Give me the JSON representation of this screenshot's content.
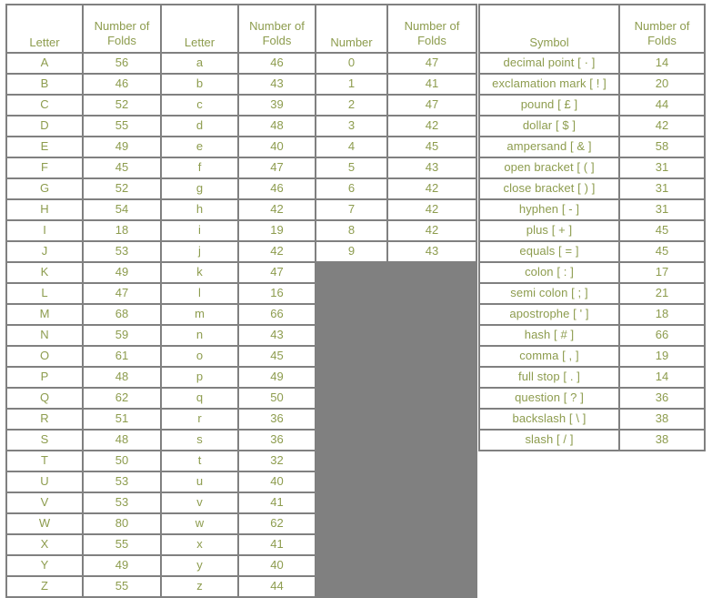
{
  "style": {
    "text_color": "#8d9c4e",
    "grid_color": "#808080",
    "background": "#ffffff"
  },
  "headers": {
    "letter_upper": "Letter",
    "folds_upper_line1": "Number of",
    "folds_upper_line2": "Folds",
    "letter_lower": "Letter",
    "folds_lower_line1": "Number of",
    "folds_lower_line2": "Folds",
    "number": "Number",
    "folds_number_line1": "Number of",
    "folds_number_line2": "Folds",
    "symbol": "Symbol",
    "folds_symbol_line1": "Number of",
    "folds_symbol_line2": "Folds"
  },
  "chart_data": {
    "type": "table",
    "title": "",
    "uppercase_letters": {
      "categories": [
        "A",
        "B",
        "C",
        "D",
        "E",
        "F",
        "G",
        "H",
        "I",
        "J",
        "K",
        "L",
        "M",
        "N",
        "O",
        "P",
        "Q",
        "R",
        "S",
        "T",
        "U",
        "V",
        "W",
        "X",
        "Y",
        "Z"
      ],
      "values": [
        56,
        46,
        52,
        55,
        49,
        45,
        52,
        54,
        18,
        53,
        49,
        47,
        68,
        59,
        61,
        48,
        62,
        51,
        48,
        50,
        53,
        53,
        80,
        55,
        49,
        55
      ]
    },
    "lowercase_letters": {
      "categories": [
        "a",
        "b",
        "c",
        "d",
        "e",
        "f",
        "g",
        "h",
        "i",
        "j",
        "k",
        "l",
        "m",
        "n",
        "o",
        "p",
        "q",
        "r",
        "s",
        "t",
        "u",
        "v",
        "w",
        "x",
        "y",
        "z"
      ],
      "values": [
        46,
        43,
        39,
        48,
        40,
        47,
        46,
        42,
        19,
        42,
        47,
        16,
        66,
        43,
        45,
        49,
        50,
        36,
        36,
        32,
        40,
        41,
        62,
        41,
        40,
        44
      ]
    },
    "numbers": {
      "categories": [
        "0",
        "1",
        "2",
        "3",
        "4",
        "5",
        "6",
        "7",
        "8",
        "9"
      ],
      "values": [
        47,
        41,
        47,
        42,
        45,
        43,
        42,
        42,
        42,
        43
      ]
    },
    "symbols": {
      "categories": [
        "decimal point [ · ]",
        "exclamation mark [ ! ]",
        "pound [ £ ]",
        "dollar [ $ ]",
        "ampersand [ & ]",
        "open bracket [ ( ]",
        "close bracket [ ) ]",
        "hyphen [ - ]",
        "plus [ + ]",
        "equals [ = ]",
        "colon [ : ]",
        "semi colon [ ; ]",
        "apostrophe [ ' ]",
        "hash [ # ]",
        "comma [ , ]",
        "full stop [ . ]",
        "question [ ? ]",
        "backslash [ \\ ]",
        "slash [ / ]"
      ],
      "values": [
        14,
        20,
        44,
        42,
        58,
        31,
        31,
        31,
        45,
        45,
        17,
        21,
        18,
        66,
        19,
        14,
        36,
        38,
        38
      ]
    }
  }
}
